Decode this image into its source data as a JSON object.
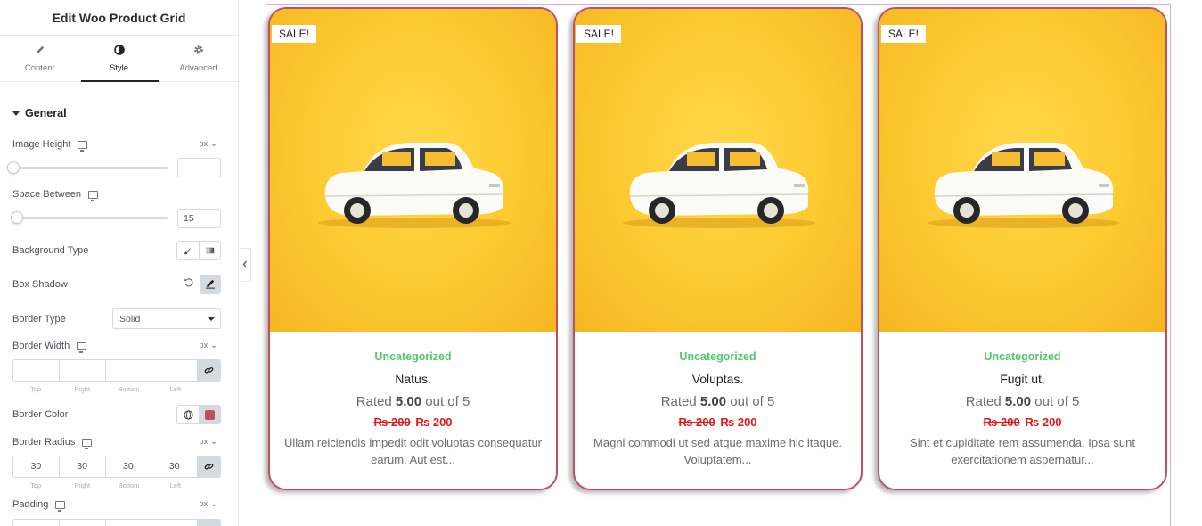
{
  "sidebar": {
    "title": "Edit Woo Product Grid",
    "tabs": [
      {
        "label": "Content",
        "icon": "pencil-icon"
      },
      {
        "label": "Style",
        "icon": "contrast-icon"
      },
      {
        "label": "Advanced",
        "icon": "gear-icon"
      }
    ],
    "section_title": "General",
    "image_height": {
      "label": "Image Height",
      "unit": "px ⌄",
      "value": ""
    },
    "space_between": {
      "label": "Space Between",
      "value": "15"
    },
    "background_type": {
      "label": "Background Type"
    },
    "box_shadow": {
      "label": "Box Shadow"
    },
    "border_type": {
      "label": "Border Type",
      "value": "Solid"
    },
    "border_width": {
      "label": "Border Width",
      "unit": "px ⌄",
      "values": [
        "",
        "",
        "",
        ""
      ]
    },
    "dimension_labels": [
      "Top",
      "Right",
      "Bottom",
      "Left"
    ],
    "border_color": {
      "label": "Border Color",
      "value": "#c0505f"
    },
    "border_radius": {
      "label": "Border Radius",
      "unit": "px ⌄",
      "values": [
        "30",
        "30",
        "30",
        "30"
      ]
    },
    "padding": {
      "label": "Padding",
      "unit": "px ⌄"
    }
  },
  "products": [
    {
      "badge": "SALE!",
      "category": "Uncategorized",
      "name": "Natus.",
      "rating_prefix": "Rated",
      "rating": "5.00",
      "rating_suffix": "out of 5",
      "old_price": "₨ 200",
      "price": "₨ 200",
      "description": "Ullam reiciendis impedit odit voluptas consequatur earum. Aut est..."
    },
    {
      "badge": "SALE!",
      "category": "Uncategorized",
      "name": "Voluptas.",
      "rating_prefix": "Rated",
      "rating": "5.00",
      "rating_suffix": "out of 5",
      "old_price": "₨ 200",
      "price": "₨ 200",
      "description": "Magni commodi ut sed atque maxime hic itaque. Voluptatem..."
    },
    {
      "badge": "SALE!",
      "category": "Uncategorized",
      "name": "Fugit ut.",
      "rating_prefix": "Rated",
      "rating": "5.00",
      "rating_suffix": "out of 5",
      "old_price": "₨ 200",
      "price": "₨ 200",
      "description": "Sint et cupiditate rem assumenda. Ipsa sunt exercitationem aspernatur..."
    }
  ],
  "colors": {
    "card_border": "#c0505f",
    "category": "#4fc96a",
    "price": "#e21818",
    "image_bg": "#fdc92f"
  }
}
